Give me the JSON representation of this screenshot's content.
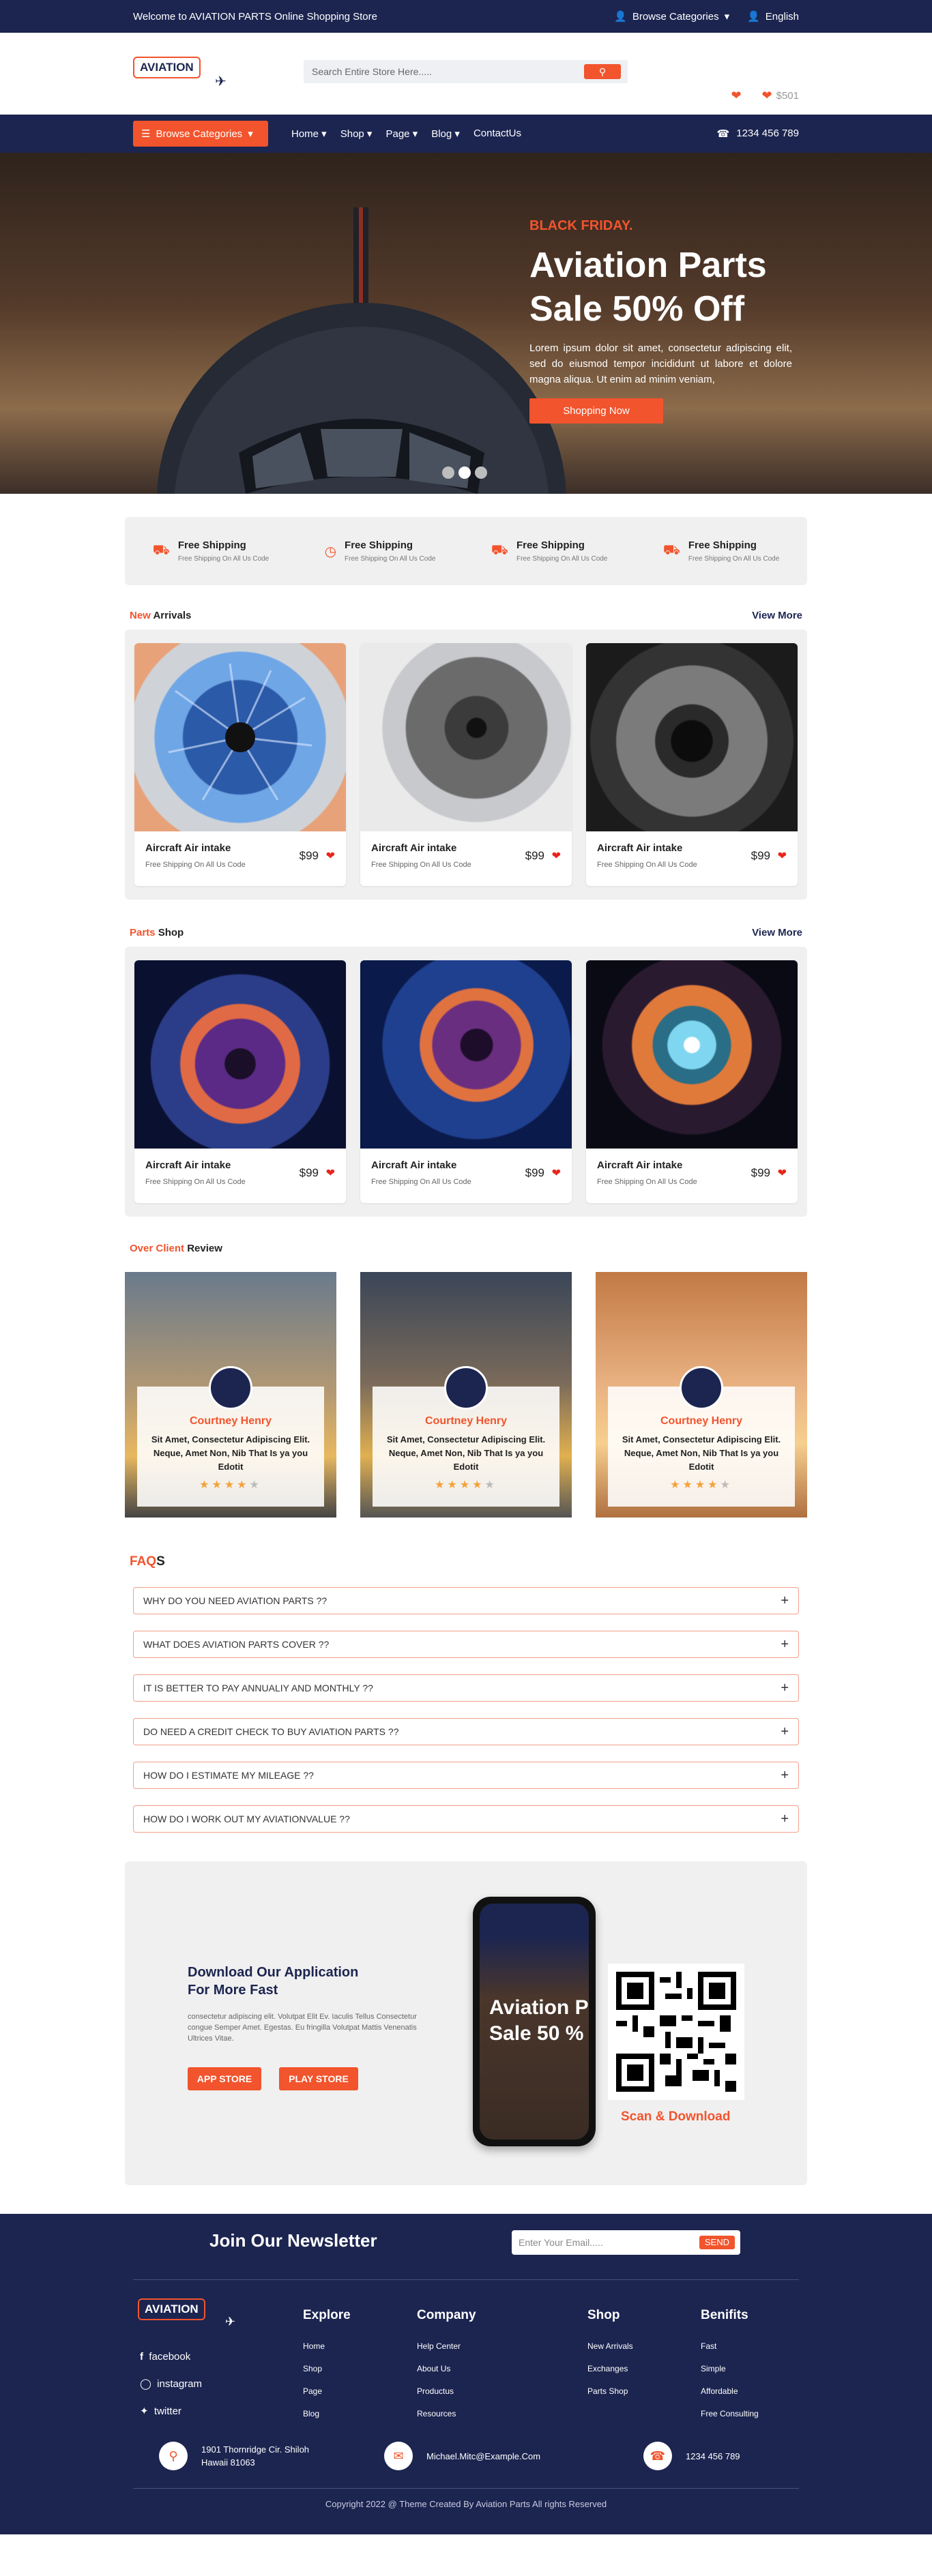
{
  "topbar": {
    "welcome": "Welcome to AVIATION PARTS Online Shopping Store",
    "browse": "Browse Categories",
    "language": "English"
  },
  "header": {
    "logo": "AVIATION",
    "search_placeholder": "Search Entire Store Here.....",
    "cart_price": "$501"
  },
  "nav": {
    "browse": "Browse Categories",
    "links": [
      "Home",
      "Shop",
      "Page",
      "Blog",
      "ContactUs"
    ],
    "phone": "1234  456  789"
  },
  "hero": {
    "kicker": "BLACK FRIDAY.",
    "title_line1": "Aviation Parts",
    "title_line2": "Sale 50% Off",
    "desc": "Lorem ipsum dolor sit amet, consectetur adipiscing elit, sed do eiusmod tempor incididunt ut labore et dolore magna aliqua. Ut enim ad minim veniam,",
    "button": "Shopping Now"
  },
  "shipping": [
    {
      "title": "Free Shipping",
      "sub": "Free Shipping On All Us Code"
    },
    {
      "title": "Free Shipping",
      "sub": "Free Shipping On All Us Code"
    },
    {
      "title": "Free Shipping",
      "sub": "Free Shipping On All Us Code"
    },
    {
      "title": "Free Shipping",
      "sub": "Free Shipping On All Us Code"
    }
  ],
  "arrivals": {
    "accent": "New",
    "title": "Arrivals",
    "view": "View More",
    "items": [
      {
        "name": "Aircraft Air intake",
        "sub": "Free Shipping On All Us Code",
        "price": "$99"
      },
      {
        "name": "Aircraft Air intake",
        "sub": "Free Shipping On All Us Code",
        "price": "$99"
      },
      {
        "name": "Aircraft Air intake",
        "sub": "Free Shipping On All Us Code",
        "price": "$99"
      }
    ]
  },
  "parts": {
    "accent": "Parts",
    "title": "Shop",
    "view": "View More",
    "items": [
      {
        "name": "Aircraft Air intake",
        "sub": "Free Shipping On All Us Code",
        "price": "$99"
      },
      {
        "name": "Aircraft Air intake",
        "sub": "Free Shipping On All Us Code",
        "price": "$99"
      },
      {
        "name": "Aircraft Air intake",
        "sub": "Free Shipping On All Us Code",
        "price": "$99"
      }
    ]
  },
  "reviews": {
    "accent": "Over Client",
    "title": "Review",
    "items": [
      {
        "name": "Courtney Henry",
        "text": "Sit Amet, Consectetur Adipiscing Elit. Neque, Amet Non, Nib That Is ya you Edotit",
        "stars": 4
      },
      {
        "name": "Courtney Henry",
        "text": "Sit Amet, Consectetur Adipiscing Elit. Neque, Amet Non, Nib That Is ya you Edotit",
        "stars": 4
      },
      {
        "name": "Courtney Henry",
        "text": "Sit Amet, Consectetur Adipiscing Elit. Neque, Amet Non, Nib That Is ya you Edotit",
        "stars": 4
      }
    ]
  },
  "faq": {
    "accent": "FAQ",
    "suffix": "S",
    "items": [
      "WHY DO YOU NEED AVIATION PARTS ??",
      "WHAT DOES AVIATION PARTS COVER ??",
      "IT IS BETTER TO PAY ANNUALIY AND MONTHLY ??",
      "DO NEED A CREDIT CHECK TO BUY AVIATION PARTS ??",
      "HOW DO I ESTIMATE MY MILEAGE ??",
      "HOW DO I WORK OUT MY AVIATIONVALUE ??"
    ]
  },
  "app": {
    "title_line1": "Download Our Application",
    "title_line2": "For More Fast",
    "desc": "consectetur adipiscing elit. Volutpat Elit Ev. Iaculis Tellus Consectetur congue Semper Amet. Egestas. Eu fringilla Volutpat Mattis Venenatis Ultrices Vitae.",
    "app_store": "APP STORE",
    "play_store": "PLAY STORE",
    "phone_text_1": "Aviation P",
    "phone_text_2": "Sale 50 %",
    "qr_label": "Scan & Download"
  },
  "footer": {
    "newsletter": "Join Our Newsletter",
    "email_placeholder": "Enter Your Email.....",
    "send": "SEND",
    "logo": "AVIATION",
    "social": [
      "facebook",
      "instagram",
      "twitter"
    ],
    "columns": [
      {
        "title": "Explore",
        "links": [
          "Home",
          "Shop",
          "Page",
          "Blog"
        ]
      },
      {
        "title": "Company",
        "links": [
          "Help Center",
          "About Us",
          "Productus",
          "Resources"
        ]
      },
      {
        "title": "Shop",
        "links": [
          "New Arrivals",
          "Exchanges",
          "Parts Shop"
        ]
      },
      {
        "title": "Benifits",
        "links": [
          "Fast",
          "Simple",
          "Affordable",
          "Free Consulting"
        ]
      }
    ],
    "address_1": "1901 Thornridge Cir. Shiloh",
    "address_2": "Hawaii 81063",
    "email": "Michael.Mitc@Example.Com",
    "phone": "1234 456 789",
    "copyright": "Copyright 2022 @ Theme Created By Aviation Parts All rights Reserved"
  },
  "colors": {
    "navy": "#1c2550",
    "accent": "#f2542d"
  }
}
